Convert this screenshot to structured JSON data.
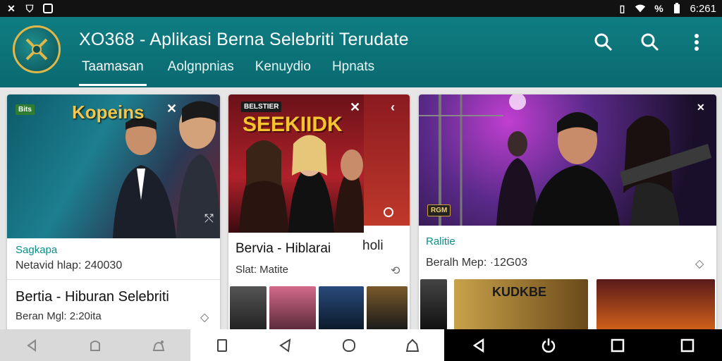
{
  "status_bar": {
    "left_icons": [
      "close-icon",
      "shield-icon",
      "image-icon"
    ],
    "time": "6:261"
  },
  "app": {
    "title": "XO368 - Aplikasi Berna Selebriti Terudate",
    "tabs": [
      {
        "label": "Taamasan",
        "active": true
      },
      {
        "label": "Aolgnpnias",
        "active": false
      },
      {
        "label": "Kenuydio",
        "active": false
      },
      {
        "label": "Hpnats",
        "active": false
      }
    ],
    "actions": [
      "search-icon",
      "search-icon",
      "more-vert-icon"
    ],
    "accent_color": "#0f7d82"
  },
  "cards": [
    {
      "badge": "Bits",
      "poster_title": "Kopeins",
      "category": "Sagkapa",
      "meta": "Netavid hlap: 240030",
      "headline": "Bertia - Hiburan Selebriti",
      "headline_meta": "Beran Mgl: 2:20ita"
    },
    {
      "badge": "BELSTIER",
      "poster_title": "SEEKIIDK",
      "headline": "Bervia - Hiblarai",
      "headline_suffix": "holi",
      "meta": "Slat: Matite"
    },
    {
      "badge_caption": "RGM",
      "category": "Ralitie",
      "meta": "Beralh Mep: ·12G03",
      "thumb_title": "KUDKBE"
    }
  ],
  "nav_bar": {
    "segments": [
      "light",
      "white",
      "dark"
    ]
  }
}
